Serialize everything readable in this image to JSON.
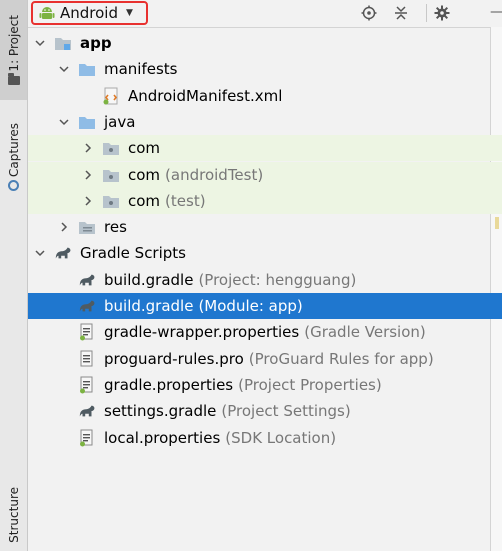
{
  "sidebar": {
    "project_tab": "1: Project",
    "captures_tab": "Captures",
    "structure_tab": "Structure"
  },
  "header": {
    "view_label": "Android",
    "remnant": "—"
  },
  "tree": [
    {
      "id": "app",
      "label": "app",
      "hint": "",
      "icon": "module-folder-icon",
      "level": 0,
      "expanded": true
    },
    {
      "id": "manifests",
      "label": "manifests",
      "hint": "",
      "icon": "folder-icon",
      "level": 1,
      "expanded": true
    },
    {
      "id": "manifest-file",
      "label": "AndroidManifest.xml",
      "hint": "",
      "icon": "xml-file-icon",
      "level": 2
    },
    {
      "id": "java",
      "label": "java",
      "hint": "",
      "icon": "folder-icon",
      "level": 1,
      "expanded": true
    },
    {
      "id": "com-main",
      "label": "com",
      "hint": "",
      "icon": "package-icon",
      "level": 2,
      "expanded": false
    },
    {
      "id": "com-androidtest",
      "label": "com",
      "hint": "(androidTest)",
      "icon": "package-icon",
      "level": 2,
      "expanded": false
    },
    {
      "id": "com-test",
      "label": "com",
      "hint": "(test)",
      "icon": "package-icon",
      "level": 2,
      "expanded": false
    },
    {
      "id": "res",
      "label": "res",
      "hint": "",
      "icon": "res-folder-icon",
      "level": 1,
      "expanded": false
    },
    {
      "id": "gradle-scripts",
      "label": "Gradle Scripts",
      "hint": "",
      "icon": "gradle-icon",
      "level": 0,
      "expanded": true
    },
    {
      "id": "build-gradle-project",
      "label": "build.gradle",
      "hint": "(Project: hengguang)",
      "icon": "gradle-icon",
      "level": 1
    },
    {
      "id": "build-gradle-module",
      "label": "build.gradle",
      "hint": "(Module: app)",
      "icon": "gradle-icon",
      "level": 1,
      "selected": true
    },
    {
      "id": "gradle-wrapper",
      "label": "gradle-wrapper.properties",
      "hint": "(Gradle Version)",
      "icon": "properties-file-icon",
      "level": 1
    },
    {
      "id": "proguard",
      "label": "proguard-rules.pro",
      "hint": "(ProGuard Rules for app)",
      "icon": "text-file-icon",
      "level": 1
    },
    {
      "id": "gradle-properties",
      "label": "gradle.properties",
      "hint": "(Project Properties)",
      "icon": "properties-file-icon",
      "level": 1
    },
    {
      "id": "settings-gradle",
      "label": "settings.gradle",
      "hint": "(Project Settings)",
      "icon": "gradle-icon",
      "level": 1
    },
    {
      "id": "local-properties",
      "label": "local.properties",
      "hint": "(SDK Location)",
      "icon": "properties-file-icon",
      "level": 1
    }
  ],
  "colors": {
    "selection": "#1f77cf",
    "highlight_row": "#edf5e3",
    "annotation_box": "#e8312f",
    "android_green": "#7cb342",
    "folder_blue": "#8fbce6",
    "gradle_gray": "#4f5b62"
  }
}
